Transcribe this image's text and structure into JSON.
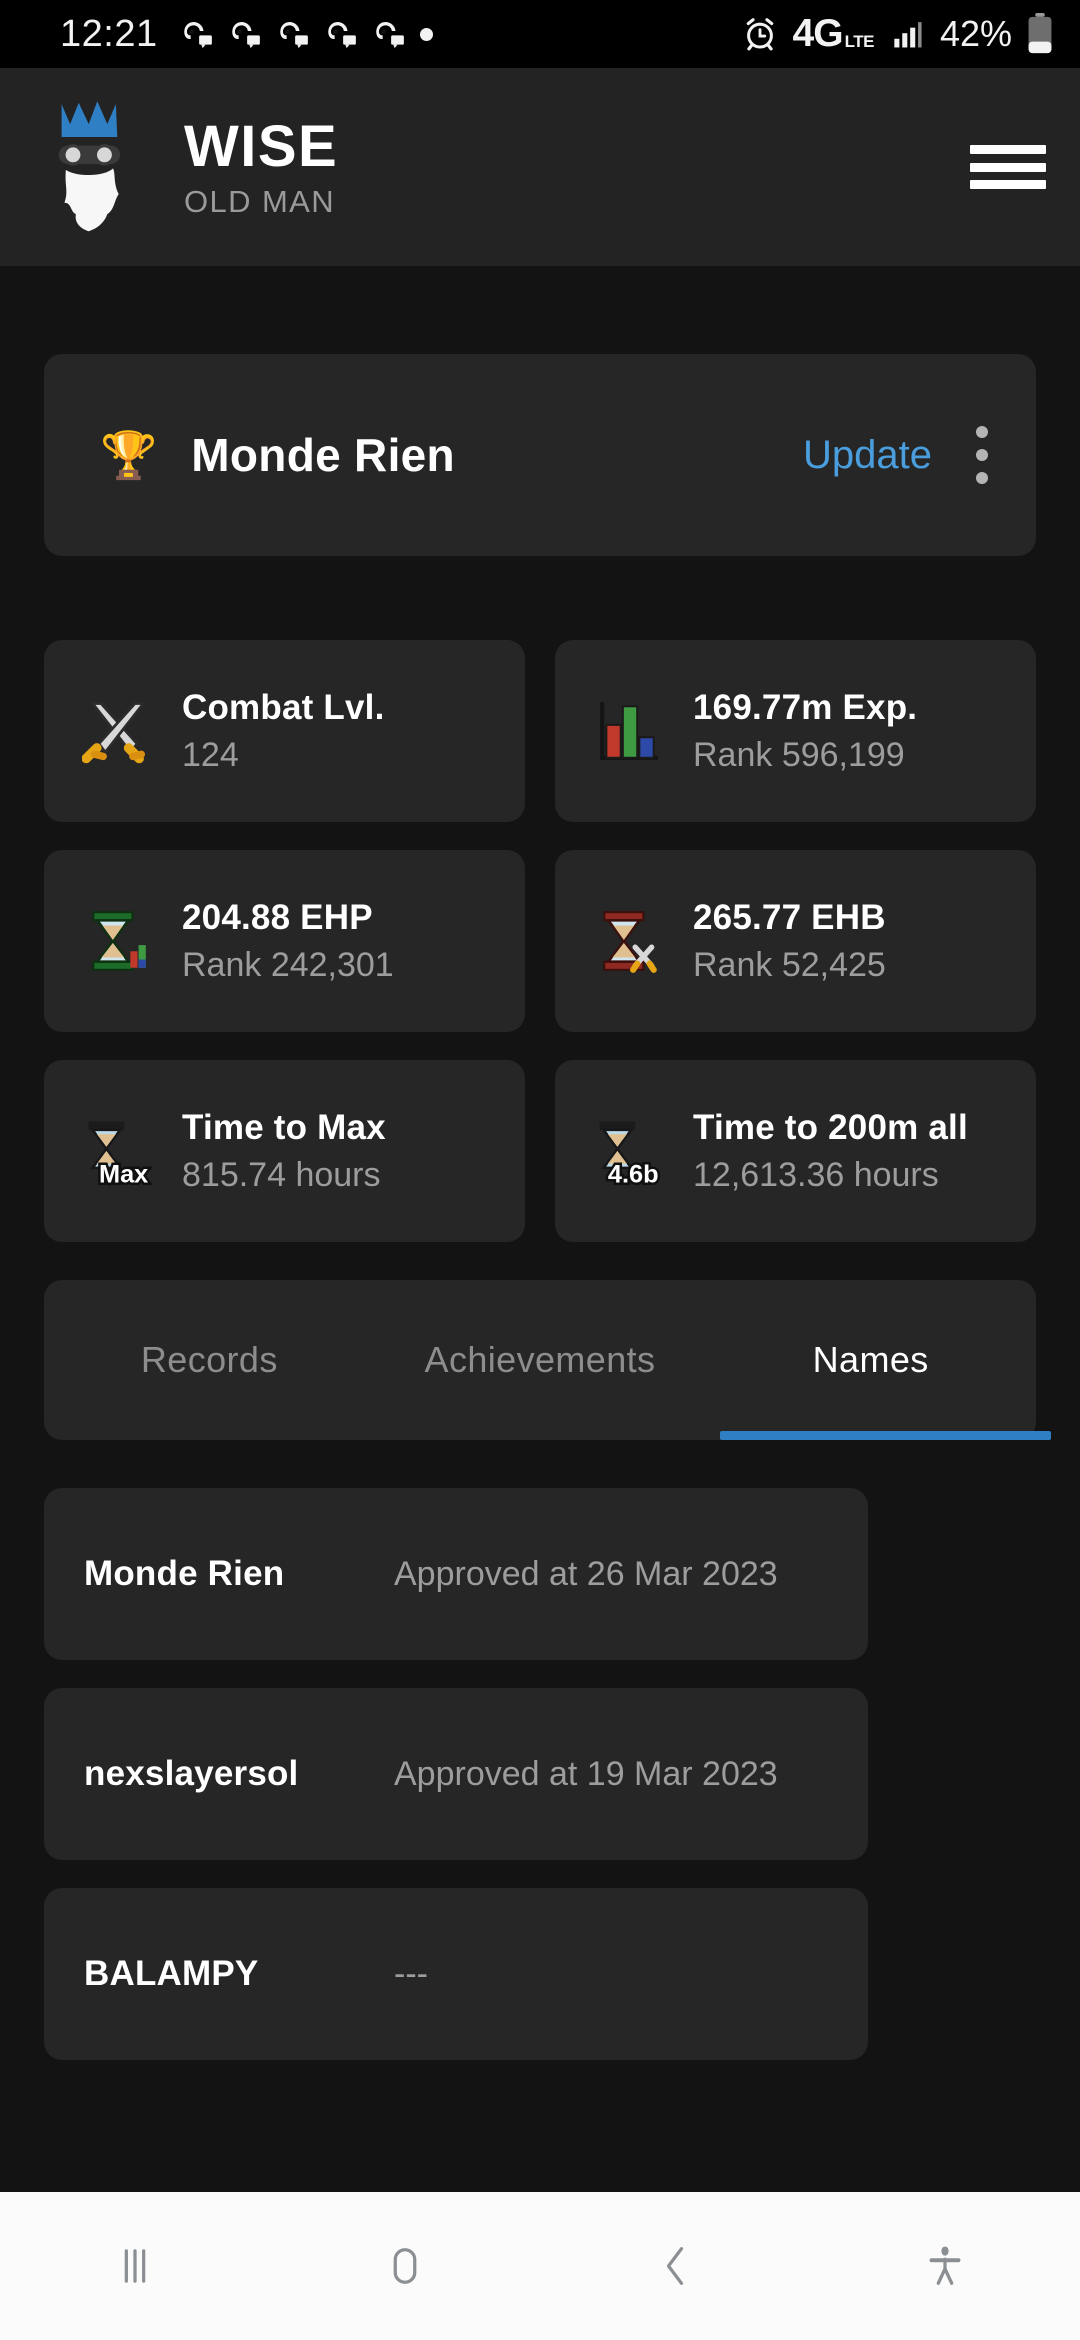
{
  "status_bar": {
    "clock": "12:21",
    "notification_icons": [
      "discord-icon",
      "discord-icon",
      "discord-icon",
      "discord-icon",
      "discord-icon",
      "dot-icon"
    ],
    "alarm_icon": "alarm-icon",
    "network": "4G",
    "network_sub": "LTE",
    "signal_icon": "signal-bars-icon",
    "battery_percent": "42%",
    "battery_icon": "battery-icon"
  },
  "app_header": {
    "logo_icon": "wise-old-man-logo-icon",
    "title": "WISE",
    "subtitle": "OLD MAN",
    "menu_icon": "hamburger-menu-icon",
    "background": "#232323"
  },
  "player": {
    "icon": "trophy-icon",
    "name": "Monde Rien",
    "update_label": "Update",
    "menu_icon": "kebab-menu-icon",
    "accent_color": "#4a9ede"
  },
  "stats": [
    {
      "icon": "crossed-swords-icon",
      "title": "Combat Lvl.",
      "sub": "124"
    },
    {
      "icon": "bar-chart-icon",
      "title": "169.77m Exp.",
      "sub": "Rank 596,199"
    },
    {
      "icon": "green-hourglass-icon",
      "title": "204.88 EHP",
      "sub": "Rank 242,301"
    },
    {
      "icon": "red-hourglass-icon",
      "title": "265.77 EHB",
      "sub": "Rank 52,425"
    },
    {
      "icon": "hourglass-max-icon",
      "title": "Time to Max",
      "sub": "815.74 hours",
      "badge": "Max"
    },
    {
      "icon": "hourglass-200m-icon",
      "title": "Time to 200m all",
      "sub": "12,613.36 hours",
      "badge": "4.6b"
    }
  ],
  "tabs": [
    {
      "label": "Records",
      "active": false
    },
    {
      "label": "Achievements",
      "active": false
    },
    {
      "label": "Names",
      "active": true
    }
  ],
  "tab_indicator_color": "#2f7fc4",
  "names": [
    {
      "name": "Monde Rien",
      "date": "Approved at 26 Mar 2023"
    },
    {
      "name": "nexslayersol",
      "date": "Approved at 19 Mar 2023"
    },
    {
      "name": "BALAMPY",
      "date": "---"
    }
  ],
  "nav_bar": {
    "recents_icon": "recents-icon",
    "home_icon": "home-icon",
    "back_icon": "back-chevron-icon",
    "accessibility_icon": "accessibility-icon",
    "background": "#fbfbfb"
  }
}
